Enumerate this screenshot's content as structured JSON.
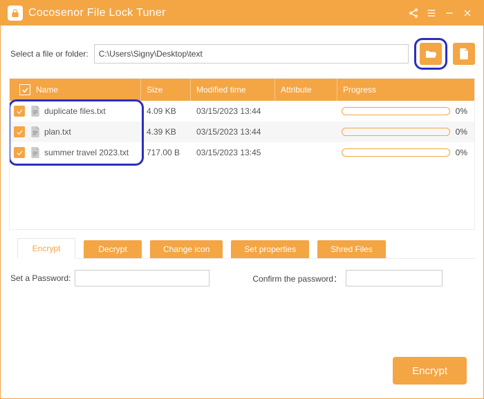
{
  "header": {
    "title": "Cocosenor File Lock Tuner"
  },
  "path": {
    "label": "Select a file or folder:",
    "value": "C:\\Users\\Signy\\Desktop\\text"
  },
  "table": {
    "columns": {
      "name": "Name",
      "size": "Size",
      "modified": "Modified time",
      "attribute": "Attribute",
      "progress": "Progress"
    },
    "rows": [
      {
        "checked": true,
        "name": "duplicate files.txt",
        "size": "4.09 KB",
        "modified": "03/15/2023 13:44",
        "attribute": "",
        "progress_pct": "0%"
      },
      {
        "checked": true,
        "name": "plan.txt",
        "size": "4.39 KB",
        "modified": "03/15/2023 13:44",
        "attribute": "",
        "progress_pct": "0%"
      },
      {
        "checked": true,
        "name": "summer travel 2023.txt",
        "size": "717.00 B",
        "modified": "03/15/2023 13:45",
        "attribute": "",
        "progress_pct": "0%"
      }
    ]
  },
  "tabs": {
    "encrypt": "Encrypt",
    "decrypt": "Decrypt",
    "change_icon": "Change icon",
    "set_properties": "Set properties",
    "shred_files": "Shred Files"
  },
  "password": {
    "set_label": "Set a Password:",
    "confirm_label": "Confirm the password：",
    "set_value": "",
    "confirm_value": ""
  },
  "buttons": {
    "encrypt": "Encrypt"
  }
}
